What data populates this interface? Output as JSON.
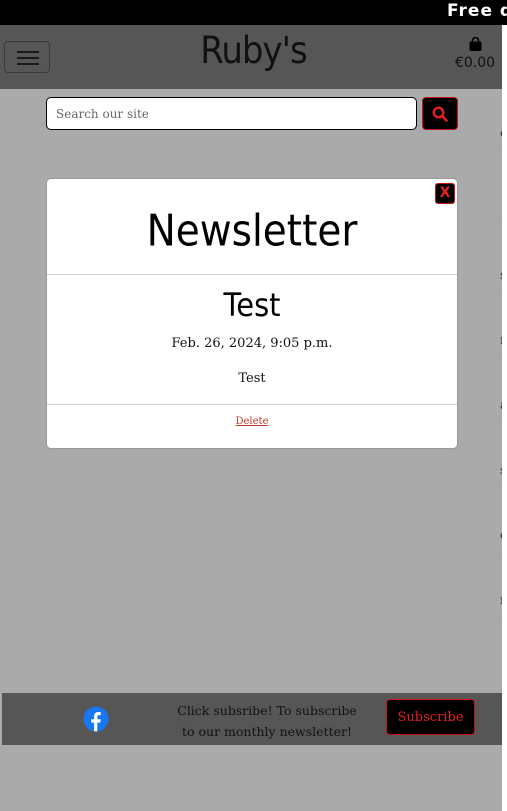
{
  "banner": {
    "text": "Free d"
  },
  "header": {
    "brand": "Ruby's",
    "cart_total": "€0.00",
    "menu_icon": "hamburger-icon",
    "cart_icon": "shopping-bag-icon"
  },
  "search": {
    "placeholder": "Search our site",
    "button_icon": "search-icon"
  },
  "side_slivers": [
    "e",
    "",
    "s,",
    "n",
    "a",
    "s",
    "e",
    "n"
  ],
  "modal": {
    "title": "Newsletter",
    "close_label": "X",
    "post": {
      "title": "Test",
      "date": "Feb. 26, 2024, 9:05 p.m.",
      "body": "Test"
    },
    "delete_label": "Delete"
  },
  "footer": {
    "social_icon": "facebook-icon",
    "text_line1": "Click subsribe! To subscribe",
    "text_line2": "to our monthly newsletter!",
    "subscribe_label": "Subscribe"
  },
  "colors": {
    "accent": "#e62020",
    "facebook": "#1877f2",
    "header_bg": "#565656",
    "page_bg": "#aaaaaa"
  }
}
